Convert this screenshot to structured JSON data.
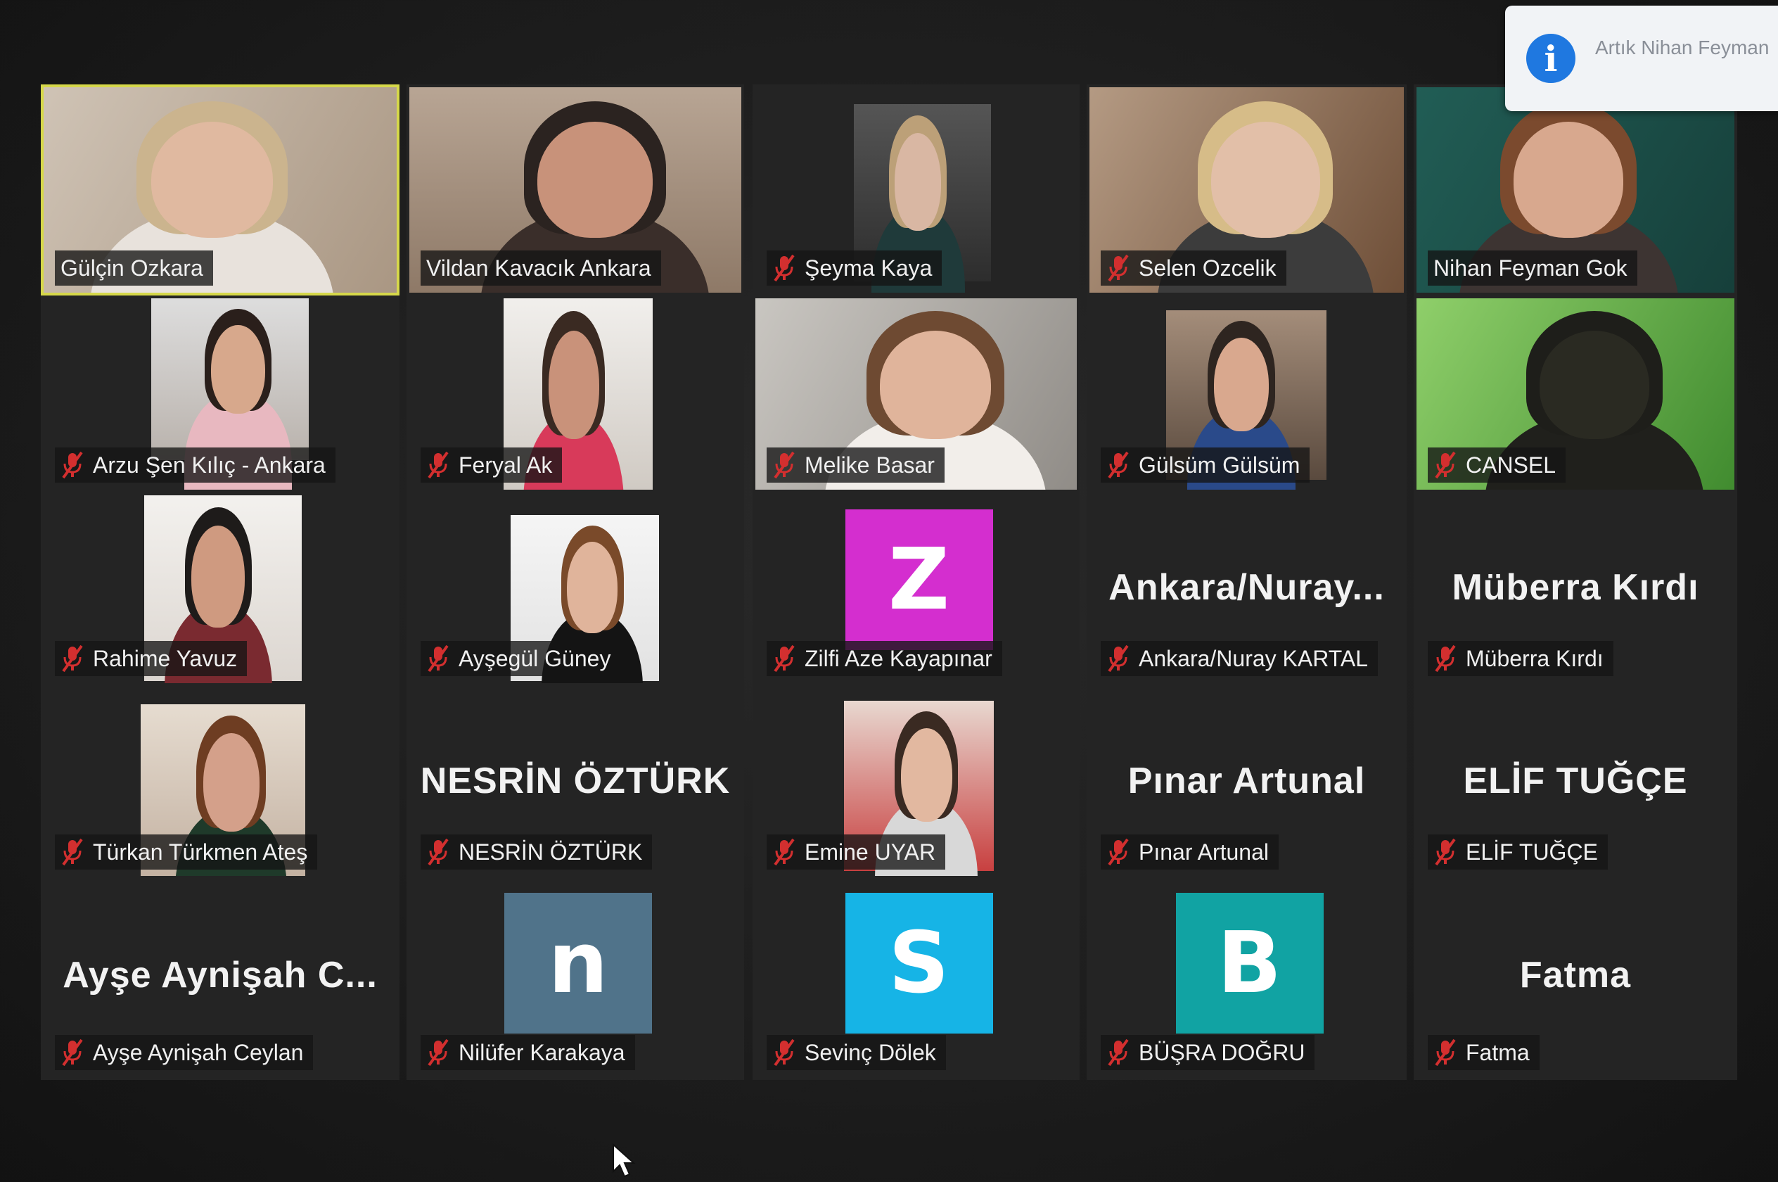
{
  "notification": {
    "text": "Artık Nihan Feyman",
    "icon": "info-icon"
  },
  "participants": [
    {
      "name": "Gülçin Ozkara",
      "muted": false,
      "active": true,
      "type": "video"
    },
    {
      "name": "Vildan Kavacık Ankara",
      "muted": false,
      "active": false,
      "type": "video"
    },
    {
      "name": "Şeyma Kaya",
      "muted": true,
      "active": false,
      "type": "video"
    },
    {
      "name": "Selen Ozcelik",
      "muted": true,
      "active": false,
      "type": "video"
    },
    {
      "name": "Nihan Feyman Gok",
      "muted": false,
      "active": false,
      "type": "video"
    },
    {
      "name": "Arzu Şen Kılıç - Ankara",
      "muted": true,
      "active": false,
      "type": "video"
    },
    {
      "name": "Feryal Ak",
      "muted": true,
      "active": false,
      "type": "video"
    },
    {
      "name": "Melike Basar",
      "muted": true,
      "active": false,
      "type": "video"
    },
    {
      "name": "Gülsüm Gülsüm",
      "muted": true,
      "active": false,
      "type": "video"
    },
    {
      "name": "CANSEL",
      "muted": true,
      "active": false,
      "type": "video"
    },
    {
      "name": "Rahime Yavuz",
      "muted": true,
      "active": false,
      "type": "video"
    },
    {
      "name": "Ayşegül Güney",
      "muted": true,
      "active": false,
      "type": "video"
    },
    {
      "name": "Zilfi Aze Kayapınar",
      "muted": true,
      "active": false,
      "type": "avatar",
      "letter": "Z",
      "color": "#d42ecf"
    },
    {
      "name": "Ankara/Nuray KARTAL",
      "muted": true,
      "active": false,
      "type": "text",
      "display": "Ankara/Nuray..."
    },
    {
      "name": "Müberra Kırdı",
      "muted": true,
      "active": false,
      "type": "text",
      "display": "Müberra Kırdı"
    },
    {
      "name": "Türkan Türkmen Ateş",
      "muted": true,
      "active": false,
      "type": "video"
    },
    {
      "name": "NESRİN ÖZTÜRK",
      "muted": true,
      "active": false,
      "type": "text",
      "display": "NESRİN ÖZTÜRK"
    },
    {
      "name": "Emine UYAR",
      "muted": true,
      "active": false,
      "type": "video"
    },
    {
      "name": "Pınar Artunal",
      "muted": true,
      "active": false,
      "type": "text",
      "display": "Pınar Artunal"
    },
    {
      "name": "ELİF TUĞÇE",
      "muted": true,
      "active": false,
      "type": "text",
      "display": "ELİF TUĞÇE"
    },
    {
      "name": "Ayşe Aynişah Ceylan",
      "muted": true,
      "active": false,
      "type": "text",
      "display": "Ayşe Aynişah C..."
    },
    {
      "name": "Nilüfer Karakaya",
      "muted": true,
      "active": false,
      "type": "avatar",
      "letter": "n",
      "color": "#50738a"
    },
    {
      "name": "Sevinç Dölek",
      "muted": true,
      "active": false,
      "type": "avatar",
      "letter": "S",
      "color": "#16b4e6"
    },
    {
      "name": "BÜŞRA DOĞRU",
      "muted": true,
      "active": false,
      "type": "avatar",
      "letter": "B",
      "color": "#11a3a3"
    },
    {
      "name": "Fatma",
      "muted": true,
      "active": false,
      "type": "text",
      "display": "Fatma"
    }
  ]
}
